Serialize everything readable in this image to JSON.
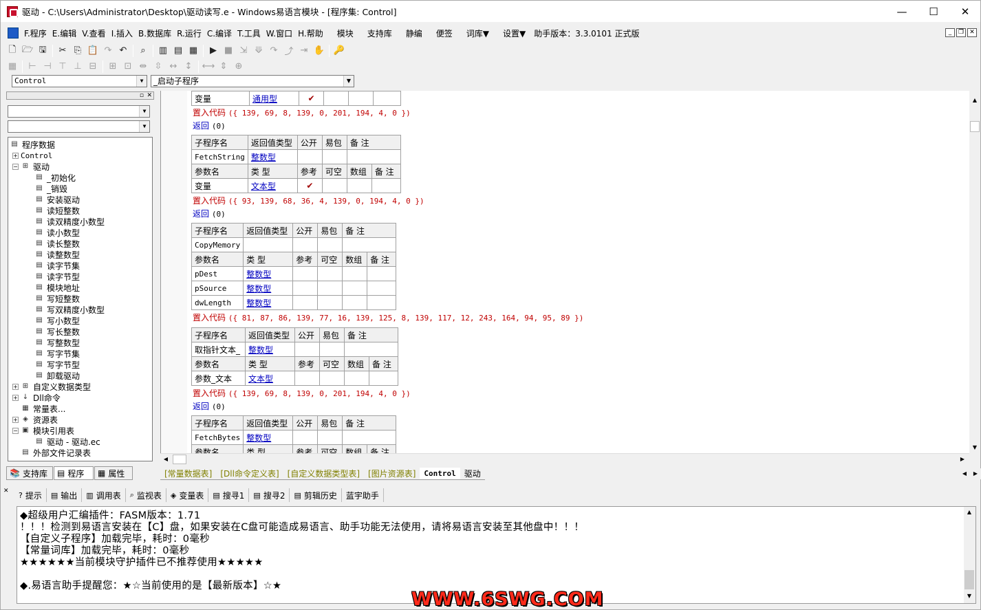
{
  "window": {
    "title": "驱动 - C:\\Users\\Administrator\\Desktop\\驱动读写.e - Windows易语言模块 - [程序集: Control]",
    "minimize": "—",
    "maximize": "☐",
    "close": "✕"
  },
  "menu": [
    "F.程序",
    "E.编辑",
    "V.查看",
    "I.插入",
    "B.数据库",
    "R.运行",
    "C.编译",
    "T.工具",
    "W.窗口",
    "H.帮助",
    "模块",
    "支持库",
    "静编",
    "便签",
    "词库▼",
    "设置▼",
    "助手版本：3.3.0101 正式版"
  ],
  "combos": {
    "class": "Control",
    "sub": "_启动子程序",
    "left1": "",
    "left2": ""
  },
  "tree": [
    {
      "label": "程序数据",
      "level": 0,
      "exp": "",
      "icon": "▤"
    },
    {
      "label": "Control",
      "level": 1,
      "exp": "+",
      "icon": "",
      "mono": true
    },
    {
      "label": "驱动",
      "level": 1,
      "exp": "−",
      "icon": "⊞"
    },
    {
      "label": "_初始化",
      "level": 2,
      "icon": "▤"
    },
    {
      "label": "_销毁",
      "level": 2,
      "icon": "▤"
    },
    {
      "label": "安装驱动",
      "level": 2,
      "icon": "▤"
    },
    {
      "label": "读短整数",
      "level": 2,
      "icon": "▤"
    },
    {
      "label": "读双精度小数型",
      "level": 2,
      "icon": "▤"
    },
    {
      "label": "读小数型",
      "level": 2,
      "icon": "▤"
    },
    {
      "label": "读长整数",
      "level": 2,
      "icon": "▤"
    },
    {
      "label": "读整数型",
      "level": 2,
      "icon": "▤"
    },
    {
      "label": "读字节集",
      "level": 2,
      "icon": "▤"
    },
    {
      "label": "读字节型",
      "level": 2,
      "icon": "▤"
    },
    {
      "label": "模块地址",
      "level": 2,
      "icon": "▤"
    },
    {
      "label": "写短整数",
      "level": 2,
      "icon": "▤"
    },
    {
      "label": "写双精度小数型",
      "level": 2,
      "icon": "▤"
    },
    {
      "label": "写小数型",
      "level": 2,
      "icon": "▤"
    },
    {
      "label": "写长整数",
      "level": 2,
      "icon": "▤"
    },
    {
      "label": "写整数型",
      "level": 2,
      "icon": "▤"
    },
    {
      "label": "写字节集",
      "level": 2,
      "icon": "▤"
    },
    {
      "label": "写字节型",
      "level": 2,
      "icon": "▤"
    },
    {
      "label": "卸载驱动",
      "level": 2,
      "icon": "▤"
    },
    {
      "label": "自定义数据类型",
      "level": 1,
      "exp": "+",
      "icon": "⊞"
    },
    {
      "label": "Dll命令",
      "level": 1,
      "exp": "+",
      "icon": "↓"
    },
    {
      "label": "常量表...",
      "level": 1,
      "icon": "▦"
    },
    {
      "label": "资源表",
      "level": 1,
      "exp": "+",
      "icon": "◈"
    },
    {
      "label": "模块引用表",
      "level": 1,
      "exp": "−",
      "icon": "▣"
    },
    {
      "label": "驱动 - 驱动.ec",
      "level": 2,
      "icon": "▤"
    },
    {
      "label": "外部文件记录表",
      "level": 1,
      "icon": "▤"
    }
  ],
  "left_tabs": [
    "支持库",
    "程序",
    "属性"
  ],
  "editor": {
    "row0": [
      "变量",
      "通用型",
      "✔",
      "",
      "",
      ""
    ],
    "code1": {
      "kw": "置入代码",
      "args": "({ 139, 69, 8, 139, 0, 201, 194, 4, 0 })"
    },
    "ret1": {
      "kw": "返回",
      "args": "(0)"
    },
    "hdr": [
      "子程序名",
      "返回值类型",
      "公开",
      "易包",
      "备 注"
    ],
    "phdr": [
      "参数名",
      "类 型",
      "参考",
      "可空",
      "数组",
      "备 注"
    ],
    "sub2": {
      "name": "FetchString",
      "type": "整数型"
    },
    "p2": [
      [
        "变量",
        "文本型",
        "✔",
        "",
        "",
        ""
      ]
    ],
    "code2": {
      "kw": "置入代码",
      "args": "({ 93, 139, 68, 36, 4, 139, 0, 194, 4, 0 })"
    },
    "ret2": {
      "kw": "返回",
      "args": "(0)"
    },
    "sub3": {
      "name": "CopyMemory",
      "type": ""
    },
    "p3": [
      [
        "pDest",
        "整数型",
        "",
        "",
        "",
        ""
      ],
      [
        "pSource",
        "整数型",
        "",
        "",
        "",
        ""
      ],
      [
        "dwLength",
        "整数型",
        "",
        "",
        "",
        ""
      ]
    ],
    "code3": {
      "kw": "置入代码",
      "args": "({ 81, 87, 86, 139, 77, 16, 139, 125, 8, 139, 117, 12, 243, 164, 94, 95, 89 })"
    },
    "sub4": {
      "name": "取指针文本_",
      "type": "整数型"
    },
    "p4": [
      [
        "参数_文本",
        "文本型",
        "",
        "",
        "",
        ""
      ]
    ],
    "code4": {
      "kw": "置入代码",
      "args": "({ 139, 69, 8, 139, 0, 201, 194, 4, 0 })"
    },
    "ret4": {
      "kw": "返回",
      "args": "(0)"
    },
    "sub5": {
      "name": "FetchBytes",
      "type": "整数型"
    }
  },
  "editor_tabs": [
    "[常量数据表]",
    "[Dll命令定义表]",
    "[自定义数据类型表]",
    "[图片资源表]",
    "Control",
    "驱动"
  ],
  "output_tabs": [
    [
      "?",
      "提示"
    ],
    [
      "▤",
      "输出"
    ],
    [
      "▥",
      "调用表"
    ],
    [
      "⌕",
      "监视表"
    ],
    [
      "◈",
      "变量表"
    ],
    [
      "▤",
      "搜寻1"
    ],
    [
      "▤",
      "搜寻2"
    ],
    [
      "▤",
      "剪辑历史"
    ],
    [
      "",
      "蓝宇助手"
    ]
  ],
  "output_lines": [
    "◆超级用户汇编插件：FASM版本：1.71",
    "！！！检测到易语言安装在【C】盘，如果安装在C盘可能造成易语言、助手功能无法使用，请将易语言安装至其他盘中！！！",
    "【自定义子程序】加载完毕，耗时：0毫秒",
    "【常量词库】加载完毕，耗时：0毫秒",
    "★★★★★★当前模块守护插件已不推荐使用★★★★★",
    "",
    "◆.易语言助手提醒您：★☆当前使用的是【最新版本】☆★"
  ],
  "watermark": "WWW.6SWG.COM"
}
